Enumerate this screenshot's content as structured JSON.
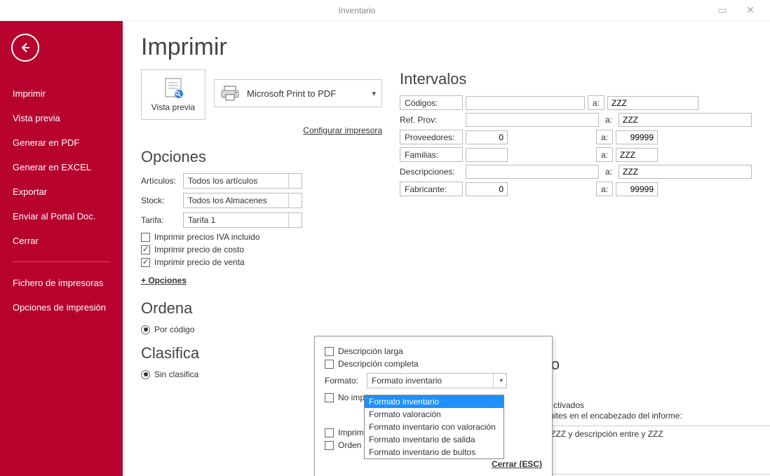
{
  "window": {
    "title": "Inventario"
  },
  "sidebar": {
    "items": [
      "Imprimir",
      "Vista previa",
      "Generar en PDF",
      "Generar en EXCEL",
      "Exportar",
      "Enviar al Portal Doc.",
      "Cerrar"
    ],
    "items2": [
      "Fichero de impresoras",
      "Opciones de impresión"
    ]
  },
  "page_title": "Imprimir",
  "preview": {
    "label": "Vista previa"
  },
  "printer": {
    "name": "Microsoft Print to PDF",
    "config_link": "Configurar impresora"
  },
  "options": {
    "header": "Opciones",
    "articulos_label": "Artículos:",
    "articulos_value": "Todos los artículos",
    "stock_label": "Stock:",
    "stock_value": "Todos los Almacenes",
    "tarifa_label": "Tarifa:",
    "tarifa_value": "Tarifa 1",
    "chk_iva": "Imprimir precios IVA incluido",
    "chk_costo": "Imprimir precio de costo",
    "chk_venta": "Imprimir precio de venta",
    "plus": "+ Opciones"
  },
  "orden": {
    "header": "Ordena",
    "radio1": "Por código"
  },
  "clasifica": {
    "header": "Clasifica",
    "radio1": "Sin clasifica"
  },
  "intervals": {
    "header": "Intervalos",
    "a": "a:",
    "codigos": {
      "label": "Códigos:",
      "from": "",
      "to": "ZZZ"
    },
    "refprov": {
      "label": "Ref. Prov:",
      "from": "",
      "to": "ZZZ"
    },
    "provee": {
      "label": "Proveedores:",
      "from": "0",
      "to": "99999"
    },
    "familias": {
      "label": "Familias:",
      "from": "",
      "to": "ZZZ"
    },
    "desc": {
      "label": "Descripciones:",
      "from": "",
      "to": "ZZZ"
    },
    "fabric": {
      "label": "Fabricante:",
      "from": "0",
      "to": "99999"
    }
  },
  "popup": {
    "chk_larga": "Descripción larga",
    "chk_completa": "Descripción completa",
    "formato_label": "Formato:",
    "formato_value": "Formato inventario",
    "chk_noimp": "No imp",
    "chk_imprimi": "Imprimi",
    "chk_orden": "Orden inverso",
    "close": "Cerrar (ESC)"
  },
  "dropdown": {
    "items": [
      "Formato inventario",
      "Formato valoración",
      "Formato inventario con valoración",
      "Formato inventario de salida",
      "Formato inventario de bultos"
    ],
    "selected_index": 0
  },
  "bg": {
    "ezado": "ezado",
    "ctivados": "ctivados",
    "limites": "xto de límites en el encabezado del informe:",
    "textarea": "entre  y ZZZ y descripción entre  y ZZZ"
  }
}
